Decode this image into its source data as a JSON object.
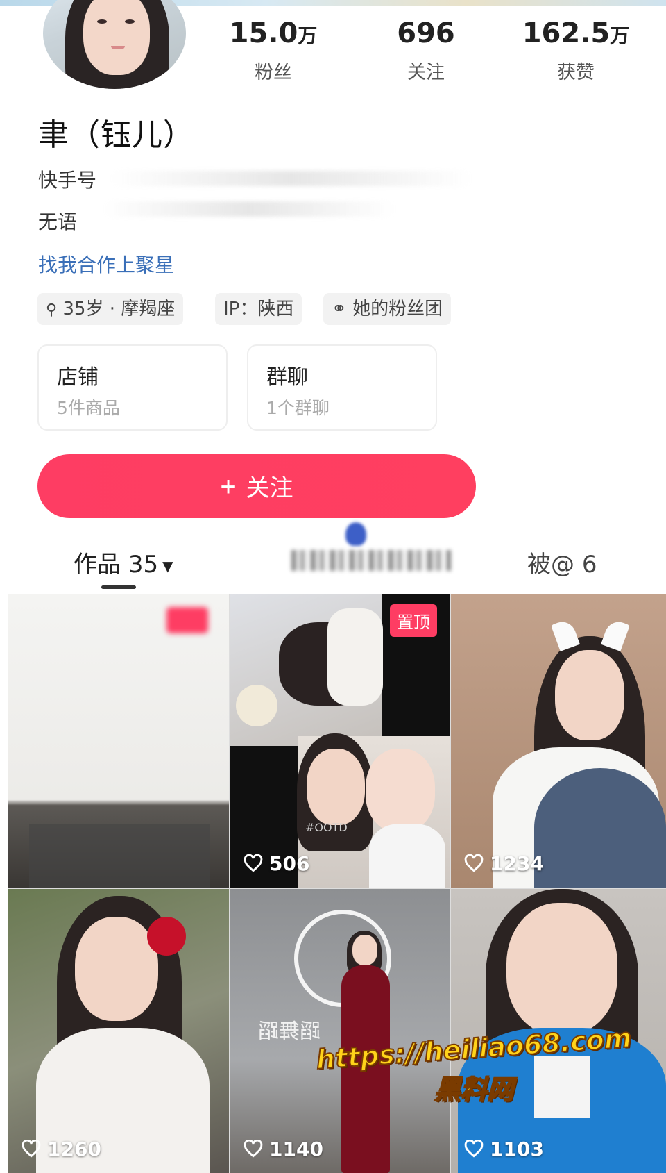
{
  "profile": {
    "stats": [
      {
        "value": "15.0",
        "unit": "万",
        "label": "粉丝"
      },
      {
        "value": "696",
        "unit": "",
        "label": "关注"
      },
      {
        "value": "162.5",
        "unit": "万",
        "label": "获赞"
      }
    ],
    "name": "聿（钰儿）",
    "account_label": "快手号",
    "bio": "无语",
    "promo": "找我合作上聚星",
    "tags": [
      "35岁 · 摩羯座",
      "IP：陕西",
      "她的粉丝团"
    ],
    "cards": [
      {
        "title": "店铺",
        "subtitle": "5件商品"
      },
      {
        "title": "群聊",
        "subtitle": "1个群聊"
      }
    ],
    "follow_button": "关注"
  },
  "tabs": {
    "works": {
      "label": "作品",
      "count": "35"
    },
    "mentioned": {
      "label": "被@",
      "count": "6"
    }
  },
  "grid": {
    "items": [
      {
        "likes": "",
        "pinned": false
      },
      {
        "likes": "506",
        "pinned": true,
        "pin_label": "置顶",
        "hashtag": "#OOTD"
      },
      {
        "likes": "1234",
        "pinned": false
      },
      {
        "likes": "1260",
        "pinned": false
      },
      {
        "likes": "1140",
        "pinned": false,
        "sign_text": "蹈舞蹈"
      },
      {
        "likes": "1103",
        "pinned": false
      }
    ]
  },
  "watermark": {
    "url": "https://heiliao68.com",
    "site": "黑料网"
  },
  "colors": {
    "accent": "#fe3d63",
    "link": "#3a6fb8"
  }
}
